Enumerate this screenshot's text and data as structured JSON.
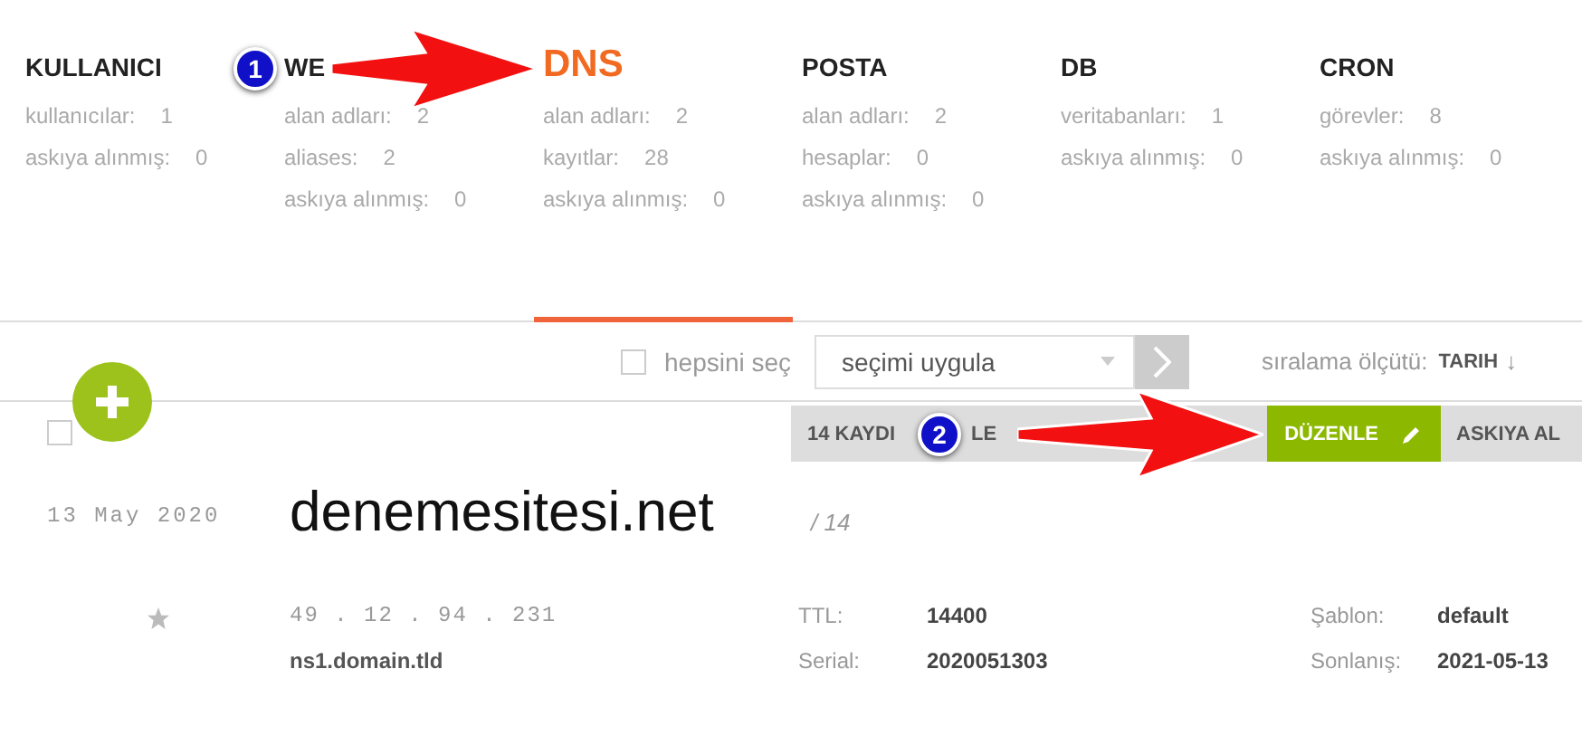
{
  "stats": [
    {
      "title": "KULLANICI",
      "selected": false,
      "rows": [
        {
          "label": "kullanıcılar:",
          "value": "1"
        },
        {
          "label": "askıya alınmış:",
          "value": "0"
        }
      ]
    },
    {
      "title": "WE",
      "selected": false,
      "rows": [
        {
          "label": "alan adları:",
          "value": "2"
        },
        {
          "label": "aliases:",
          "value": "2"
        },
        {
          "label": "askıya alınmış:",
          "value": "0"
        }
      ]
    },
    {
      "title": "DNS",
      "selected": true,
      "rows": [
        {
          "label": "alan adları:",
          "value": "2"
        },
        {
          "label": "kayıtlar:",
          "value": "28"
        },
        {
          "label": "askıya alınmış:",
          "value": "0"
        }
      ]
    },
    {
      "title": "POSTA",
      "selected": false,
      "rows": [
        {
          "label": "alan adları:",
          "value": "2"
        },
        {
          "label": "hesaplar:",
          "value": "0"
        },
        {
          "label": "askıya alınmış:",
          "value": "0"
        }
      ]
    },
    {
      "title": "DB",
      "selected": false,
      "rows": [
        {
          "label": "veritabanları:",
          "value": "1"
        },
        {
          "label": "askıya alınmış:",
          "value": "0"
        }
      ]
    },
    {
      "title": "CRON",
      "selected": false,
      "rows": [
        {
          "label": "görevler:",
          "value": "8"
        },
        {
          "label": "askıya alınmış:",
          "value": "0"
        }
      ]
    }
  ],
  "toolbar": {
    "select_all": {
      "label": "hepsini seç",
      "checked": false
    },
    "action_select": {
      "value": "seçimi uygula"
    },
    "sort": {
      "label": "sıralama ölçütü:",
      "value": "TARIH",
      "arrow": "↓"
    }
  },
  "action_bar": [
    {
      "label": "14 KAYDI",
      "tail": "LE",
      "selected": false
    },
    {
      "label": "DÜZENLE",
      "selected": true
    },
    {
      "label": "ASKIYA AL",
      "selected": false
    }
  ],
  "record": {
    "checked": false,
    "date": "13 May 2020",
    "starred": false,
    "domain": "denemesitesi.net",
    "count": "/ 14",
    "ip": "49 . 12 . 94 . 231",
    "ns": "ns1.domain.tld",
    "fields": [
      {
        "label": "TTL:",
        "value": "14400"
      },
      {
        "label": "Şablon:",
        "value": "default"
      },
      {
        "label": "Serial:",
        "value": "2020051303"
      },
      {
        "label": "Sonlanış:",
        "value": "2021-05-13"
      }
    ]
  },
  "annotations": [
    {
      "number": "1"
    },
    {
      "number": "2"
    }
  ]
}
